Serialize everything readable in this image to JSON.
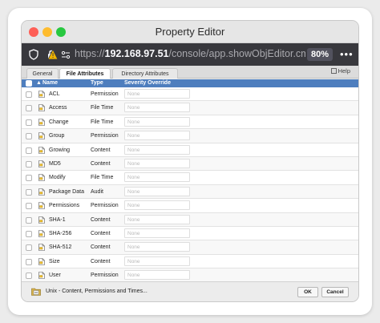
{
  "window": {
    "title": "Property Editor"
  },
  "browser": {
    "url_prefix": "https://",
    "url_host": "192.168.97.51",
    "url_path": "/console/app.showObjEditor.cmc",
    "zoom": "80%",
    "menu_dots": "•••"
  },
  "tabs": [
    {
      "label": "General",
      "active": false
    },
    {
      "label": "File Attributes",
      "active": true
    },
    {
      "label": "Directory Attributes",
      "active": false
    }
  ],
  "help_label": "Help",
  "table": {
    "headers": {
      "name": "Name",
      "type": "Type",
      "severity": "Severity Override",
      "sort_arrow": "▲"
    },
    "rows": [
      {
        "name": "ACL",
        "type": "Permission",
        "severity": "None"
      },
      {
        "name": "Access",
        "type": "File Time",
        "severity": "None"
      },
      {
        "name": "Change",
        "type": "File Time",
        "severity": "None"
      },
      {
        "name": "Group",
        "type": "Permission",
        "severity": "None"
      },
      {
        "name": "Growing",
        "type": "Content",
        "severity": "None"
      },
      {
        "name": "MD5",
        "type": "Content",
        "severity": "None"
      },
      {
        "name": "Modify",
        "type": "File Time",
        "severity": "None"
      },
      {
        "name": "Package Data",
        "type": "Audit",
        "severity": "None"
      },
      {
        "name": "Permissions",
        "type": "Permission",
        "severity": "None"
      },
      {
        "name": "SHA-1",
        "type": "Content",
        "severity": "None"
      },
      {
        "name": "SHA-256",
        "type": "Content",
        "severity": "None"
      },
      {
        "name": "SHA-512",
        "type": "Content",
        "severity": "None"
      },
      {
        "name": "Size",
        "type": "Content",
        "severity": "None"
      },
      {
        "name": "User",
        "type": "Permission",
        "severity": "None"
      }
    ]
  },
  "footer": {
    "label": "Unix - Content, Permissions and Times...",
    "ok_label": "OK",
    "cancel_label": "Cancel"
  },
  "colors": {
    "header_blue": "#4e7ebe",
    "url_bar": "#38383d"
  }
}
